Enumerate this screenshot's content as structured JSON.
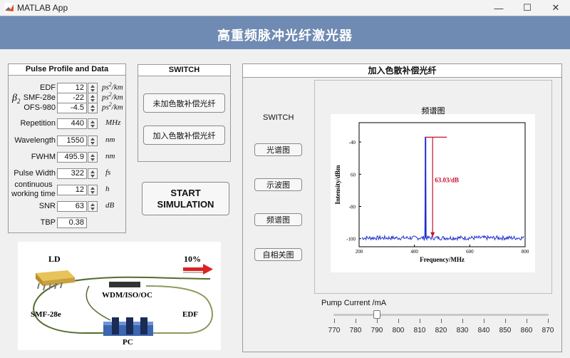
{
  "window": {
    "title": "MATLAB App",
    "minimize": "—",
    "maximize": "☐",
    "close": "✕"
  },
  "banner": {
    "title": "高重频脉冲光纤激光器"
  },
  "pulse": {
    "title": "Pulse Profile and Data",
    "beta_symbol": "β",
    "beta_sub": "2",
    "rows": [
      {
        "label": "EDF",
        "value": "12",
        "unit": "ps",
        "sup": "2",
        "unit_tail": "/km"
      },
      {
        "label": "SMF-28e",
        "value": "-22",
        "unit": "ps",
        "sup": "2",
        "unit_tail": "/km"
      },
      {
        "label": "OFS-980",
        "value": "-4.5",
        "unit": "ps",
        "sup": "2",
        "unit_tail": "/km"
      },
      {
        "label": "Repetition",
        "value": "440",
        "unit": "MHz"
      },
      {
        "label": "Wavelength",
        "value": "1550",
        "unit": "nm"
      },
      {
        "label": "FWHM",
        "value": "495.9",
        "unit": "nm"
      },
      {
        "label": "Pulse Width",
        "value": "322",
        "unit": "fs"
      },
      {
        "label": "continuous",
        "label2": "working time",
        "value": "12",
        "unit": "h"
      },
      {
        "label": "SNR",
        "value": "63",
        "unit": "dB"
      },
      {
        "label": "TBP",
        "value": "0.38",
        "unit": ""
      }
    ]
  },
  "switch_panel": {
    "title": "SWITCH",
    "btn_no_comp": "未加色散补偿光纤",
    "btn_comp": "加入色散补偿光纤"
  },
  "start": {
    "line1": "START",
    "line2": "SIMULATION"
  },
  "diagram": {
    "ld": "LD",
    "ratio": "10%",
    "wdm": "WDM/ISO/OC",
    "smf": "SMF-28e",
    "edf": "EDF",
    "pc": "PC"
  },
  "right_panel": {
    "title": "加入色散补偿光纤",
    "switch_label": "SWITCH",
    "buttons": [
      "光谱图",
      "示波图",
      "频谱图",
      "自相关图"
    ]
  },
  "plot": {
    "title": "频谱图",
    "ylabel": "Intensity/dBm",
    "xlabel": "Frequency/MHz",
    "annotation": "63.03/dB"
  },
  "chart_data": {
    "type": "line",
    "xlabel": "Frequency/MHz",
    "ylabel": "Intensity/dBm",
    "xlim": [
      200,
      800
    ],
    "ylim": [
      -105,
      -28
    ],
    "x_ticks": [
      "200",
      "400",
      "600",
      "800"
    ],
    "y_ticks": [
      "-40",
      "60",
      "-80",
      "-100"
    ],
    "peak": {
      "x": 440,
      "y": -37
    },
    "noise_floor": -99.5,
    "annotation": "63.03/dB"
  },
  "pump": {
    "label": "Pump Current /mA",
    "min": 770,
    "max": 870,
    "value": 790,
    "ticks": [
      "770",
      "780",
      "790",
      "800",
      "810",
      "820",
      "830",
      "840",
      "850",
      "860",
      "870"
    ]
  },
  "colors": {
    "banner": "#6f8bb3",
    "trace": "#1f2fcf",
    "annotation": "#c8102e"
  }
}
